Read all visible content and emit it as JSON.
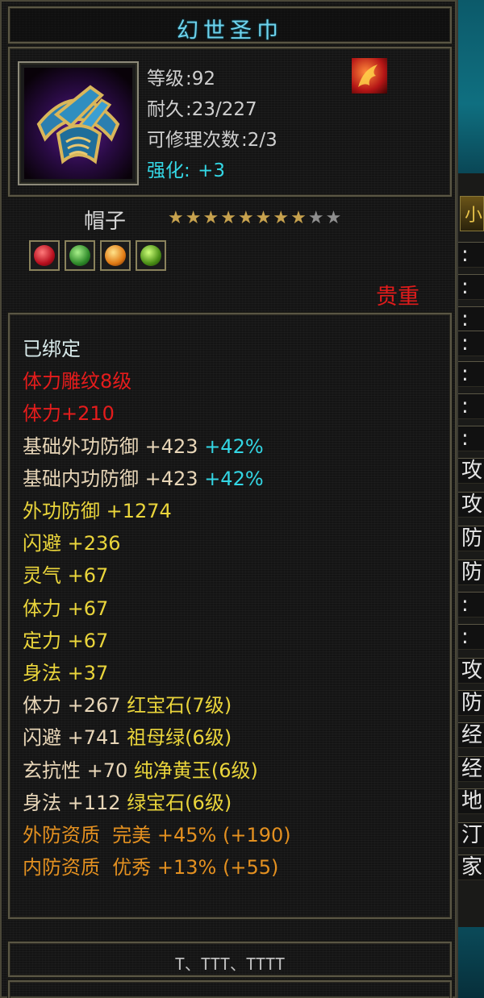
{
  "item": {
    "name": "幻世圣巾",
    "level_label": "等级",
    "level_value": ":92",
    "durability_label": "耐久",
    "durability_value": ":23/227",
    "repair_label": "可修理次数",
    "repair_value": ":2/3",
    "enhance_label": "强化:",
    "enhance_value": "+3",
    "type": "帽子",
    "stars_filled": 8,
    "stars_total": 10,
    "rarity": "贵重",
    "gem_icons": [
      "red-gem-icon",
      "green-gem-icon",
      "orange-gem-icon",
      "emerald-gem-icon"
    ]
  },
  "attributes": [
    {
      "text": "已绑定",
      "color": "white"
    },
    {
      "text": "体力雕纹8级",
      "color": "red"
    },
    {
      "text": "体力+210",
      "color": "red"
    },
    {
      "text": "基础外功防御 +423 ",
      "extra": "+42%",
      "color": "pale"
    },
    {
      "text": "基础内功防御 +423 ",
      "extra": "+42%",
      "color": "pale"
    },
    {
      "text": "外功防御 +1274",
      "color": "yellow"
    },
    {
      "text": "闪避 +236",
      "color": "yellow"
    },
    {
      "text": "灵气 +67",
      "color": "yellow"
    },
    {
      "text": "体力 +67",
      "color": "yellow"
    },
    {
      "text": "定力 +67",
      "color": "yellow"
    },
    {
      "text": "身法 +37",
      "color": "yellow"
    },
    {
      "text": "体力 +267 ",
      "extra": "红宝石(7级)",
      "color": "pale"
    },
    {
      "text": "闪避 +741 ",
      "extra": "祖母绿(6级)",
      "color": "pale"
    },
    {
      "text": "玄抗性 +70 ",
      "extra": "纯净黄玉(6级)",
      "color": "pale"
    },
    {
      "text": "身法 +112 ",
      "extra": "绿宝石(6级)",
      "color": "pale"
    },
    {
      "text": "外防资质  完美 +45% (+190)",
      "color": "orange"
    },
    {
      "text": "内防资质  优秀 +13% (+55)",
      "color": "orange"
    }
  ],
  "footer": "T、TTT、TTTT",
  "side_panel": {
    "tab_glyph": "小",
    "glyphs": [
      ":",
      ":",
      ":",
      ":",
      ":",
      ":",
      ":",
      "攻",
      "攻",
      "防",
      "防",
      ":",
      ":",
      "攻",
      "防",
      "经",
      "经",
      "地",
      "汀",
      "家"
    ]
  },
  "colors": {
    "title": "#6fd3ec",
    "rarity": "#e01b1b",
    "cyan": "#33d6e4",
    "yellow": "#ead53b",
    "orange": "#e39020",
    "red": "#e51c1c"
  }
}
